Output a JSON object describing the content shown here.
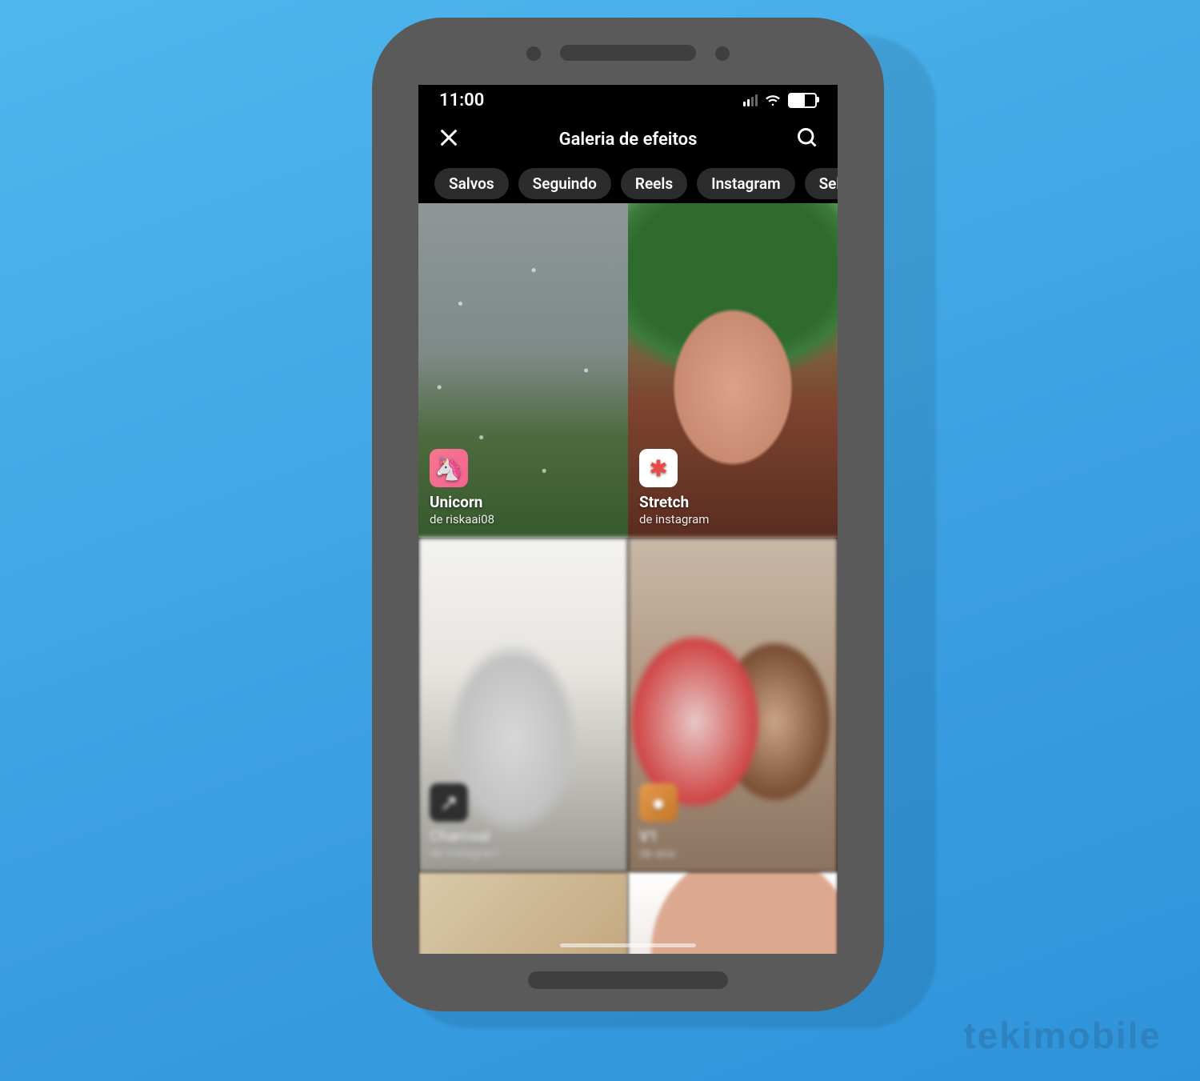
{
  "watermark": "tekimobile",
  "statusbar": {
    "time": "11:00"
  },
  "header": {
    "title": "Galeria de efeitos"
  },
  "tabs": [
    "Salvos",
    "Seguindo",
    "Reels",
    "Instagram",
    "Selfie"
  ],
  "effects": [
    {
      "name": "Unicorn",
      "author": "de riskaai08",
      "icon_emoji": "🦄",
      "icon_class": "ico-pink"
    },
    {
      "name": "Stretch",
      "author": "de instagram",
      "icon_emoji": "✱",
      "icon_class": "ico-white"
    },
    {
      "name": "Charcoal",
      "author": "de instagram",
      "icon_emoji": "↗",
      "icon_class": "ico-dark"
    },
    {
      "name": "V1",
      "author": "de ana",
      "icon_emoji": "●",
      "icon_class": "ico-orange"
    }
  ]
}
